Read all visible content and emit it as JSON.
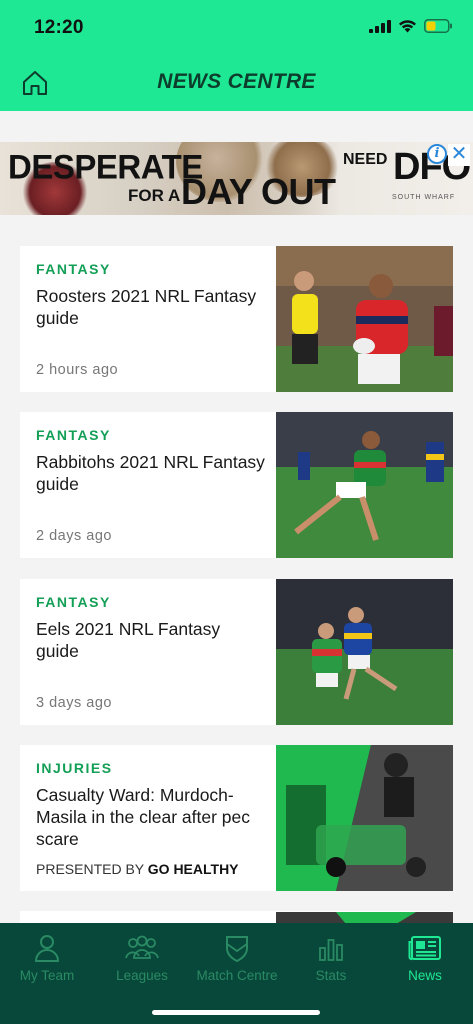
{
  "status": {
    "time": "12:20"
  },
  "header": {
    "title": "NEWS CENTRE"
  },
  "ad": {
    "line1": "DESPERATE",
    "line2_small": "FOR A",
    "line2_big": "DAY OUT",
    "need": "NEED",
    "brand": "DFO",
    "brand_sub": "SOUTH WHARF",
    "info_glyph": "i",
    "close_glyph": "✕"
  },
  "articles": [
    {
      "category": "FANTASY",
      "title": "Roosters 2021 NRL Fantasy guide",
      "time": "2 hours ago"
    },
    {
      "category": "FANTASY",
      "title": "Rabbitohs 2021 NRL Fantasy guide",
      "time": "2 days ago"
    },
    {
      "category": "FANTASY",
      "title": "Eels 2021 NRL Fantasy guide",
      "time": "3 days ago"
    },
    {
      "category": "INJURIES",
      "title": "Casualty Ward: Murdoch-Masila in the clear after pec scare",
      "presented_prefix": "PRESENTED BY",
      "presented_brand": "GO HEALTHY"
    }
  ],
  "tabs": [
    {
      "label": "My Team",
      "icon": "user-icon"
    },
    {
      "label": "Leagues",
      "icon": "group-icon"
    },
    {
      "label": "Match Centre",
      "icon": "shield-icon"
    },
    {
      "label": "Stats",
      "icon": "bar-chart-icon"
    },
    {
      "label": "News",
      "icon": "newspaper-icon",
      "active": true
    }
  ],
  "colors": {
    "brand_green": "#1ee893",
    "dark_green": "#08483a",
    "category_green": "#139f56"
  }
}
